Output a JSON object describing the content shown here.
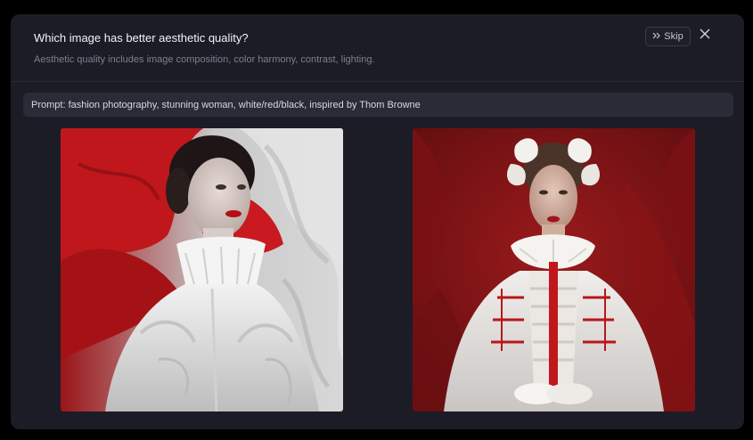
{
  "header": {
    "title": "Which image has better aesthetic quality?",
    "subtitle": "Aesthetic quality includes image composition, color harmony, contrast, lighting.",
    "skip_label": "Skip",
    "skip_icon": "double-chevron-right-icon",
    "close_icon": "close-icon"
  },
  "prompt": {
    "text": "Prompt: fashion photography, stunning woman, white/red/black, inspired by Thom Browne"
  },
  "colors": {
    "modal_bg": "#1c1c26",
    "prompt_bg": "#2b2b37",
    "accent_red": "#c0171c"
  }
}
